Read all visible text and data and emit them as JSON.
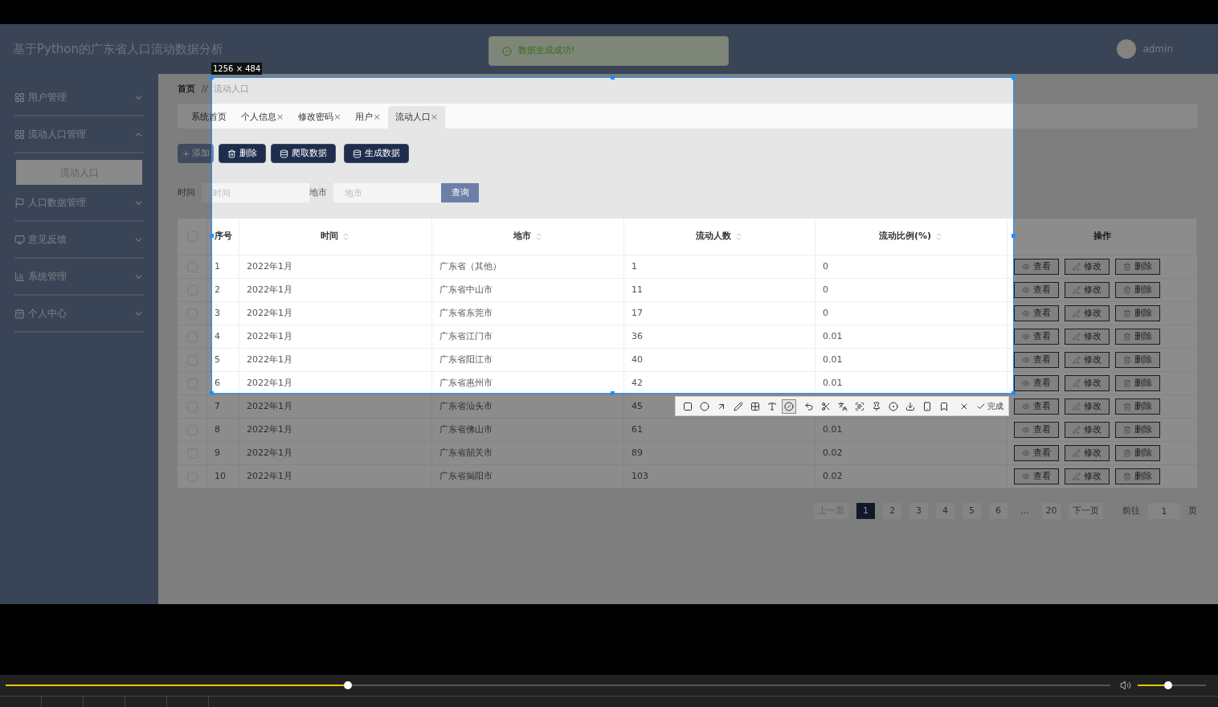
{
  "app": {
    "header": {
      "title": "基于Python的广东省人口流动数据分析",
      "user": "admin"
    },
    "toast": {
      "message": "数据生成成功!"
    },
    "sidebar": {
      "items": [
        {
          "kind": "grid",
          "label": "用户管理",
          "expanded": false
        },
        {
          "kind": "grid",
          "label": "流动人口管理",
          "expanded": true,
          "children": [
            {
              "label": "流动人口",
              "selected": true
            }
          ]
        },
        {
          "kind": "flag",
          "label": "人口数据管理",
          "expanded": false
        },
        {
          "kind": "monitor",
          "label": "意见反馈",
          "expanded": false
        },
        {
          "kind": "chart",
          "label": "系统管理",
          "expanded": false
        },
        {
          "kind": "calendar",
          "label": "个人中心",
          "expanded": false
        }
      ]
    },
    "breadcrumb": {
      "items": [
        "首页",
        "流动人口"
      ],
      "separator": "//"
    },
    "tabs": [
      {
        "label": "系统首页",
        "selected": false
      },
      {
        "label": "个人信息",
        "close": "×",
        "selected": false
      },
      {
        "label": "修改密码",
        "close": "×",
        "selected": false
      },
      {
        "label": "用户",
        "close": "×",
        "selected": false
      },
      {
        "label": "流动人口",
        "close": "×",
        "selected": true
      }
    ],
    "actions": [
      {
        "kind": "add",
        "label": "添加"
      },
      {
        "kind": "delete",
        "label": "删除"
      },
      {
        "kind": "crawl",
        "label": "爬取数据"
      },
      {
        "kind": "generate",
        "label": "生成数据"
      }
    ],
    "search": {
      "fields": [
        {
          "label": "时间",
          "placeholder": "时间"
        },
        {
          "label": "地市",
          "placeholder": "地市"
        }
      ],
      "button": "查询"
    },
    "table": {
      "columns": [
        {
          "label": "序号",
          "sortable": false
        },
        {
          "label": "时间",
          "sortable": true
        },
        {
          "label": "地市",
          "sortable": true
        },
        {
          "label": "流动人数",
          "sortable": true
        },
        {
          "label": "流动比例(%)",
          "sortable": true
        },
        {
          "label": "操作",
          "sortable": false
        }
      ],
      "select_all": {
        "checked": false
      },
      "rows": [
        {
          "checked": false,
          "no": "1",
          "time": "2022年1月",
          "city": "广东省（其他）",
          "count": "1",
          "ratio": "0",
          "actions": [
            "查看",
            "修改",
            "删除"
          ]
        },
        {
          "checked": false,
          "no": "2",
          "time": "2022年1月",
          "city": "广东省中山市",
          "count": "11",
          "ratio": "0",
          "actions": [
            "查看",
            "修改",
            "删除"
          ]
        },
        {
          "checked": false,
          "no": "3",
          "time": "2022年1月",
          "city": "广东省东莞市",
          "count": "17",
          "ratio": "0",
          "actions": [
            "查看",
            "修改",
            "删除"
          ]
        },
        {
          "checked": false,
          "no": "4",
          "time": "2022年1月",
          "city": "广东省江门市",
          "count": "36",
          "ratio": "0.01",
          "actions": [
            "查看",
            "修改",
            "删除"
          ]
        },
        {
          "checked": false,
          "no": "5",
          "time": "2022年1月",
          "city": "广东省阳江市",
          "count": "40",
          "ratio": "0.01",
          "actions": [
            "查看",
            "修改",
            "删除"
          ]
        },
        {
          "checked": false,
          "no": "6",
          "time": "2022年1月",
          "city": "广东省惠州市",
          "count": "42",
          "ratio": "0.01",
          "actions": [
            "查看",
            "修改",
            "删除"
          ]
        },
        {
          "checked": false,
          "no": "7",
          "time": "2022年1月",
          "city": "广东省汕头市",
          "count": "45",
          "actions": [
            "查看",
            "修改",
            "删除"
          ]
        },
        {
          "checked": false,
          "no": "8",
          "time": "2022年1月",
          "city": "广东省佛山市",
          "count": "61",
          "ratio": "0.01",
          "actions": [
            "查看",
            "修改",
            "删除"
          ]
        },
        {
          "checked": false,
          "no": "9",
          "time": "2022年1月",
          "city": "广东省韶关市",
          "count": "89",
          "ratio": "0.02",
          "actions": [
            "查看",
            "修改",
            "删除"
          ]
        },
        {
          "checked": false,
          "no": "10",
          "time": "2022年1月",
          "city": "广东省揭阳市",
          "count": "103",
          "ratio": "0.02",
          "actions": [
            "查看",
            "修改",
            "删除"
          ]
        }
      ]
    },
    "pagination": {
      "prev": "上一页",
      "next": "下一页",
      "pages": [
        {
          "label": "1",
          "selected": true
        },
        {
          "label": "2",
          "selected": false
        },
        {
          "label": "3",
          "selected": false
        },
        {
          "label": "4",
          "selected": false
        },
        {
          "label": "5",
          "selected": false
        },
        {
          "label": "6",
          "selected": false
        },
        {
          "label": "...",
          "kind": "more",
          "selected": false
        },
        {
          "label": "20",
          "selected": false
        }
      ],
      "goto_label": "前往",
      "goto_value": "1",
      "goto_suffix": "页"
    }
  },
  "capture": {
    "size_label": "1256 × 484",
    "done": "完成",
    "tools": [
      {
        "kind": "rectangle",
        "selected": false
      },
      {
        "kind": "ellipse",
        "selected": false
      },
      {
        "kind": "arrow",
        "selected": false
      },
      {
        "kind": "pencil",
        "selected": false
      },
      {
        "kind": "mosaic",
        "selected": false
      },
      {
        "kind": "text",
        "selected": false
      },
      {
        "kind": "marker",
        "selected": true
      },
      {
        "kind": "undo",
        "selected": false
      },
      {
        "kind": "cut",
        "selected": false
      },
      {
        "kind": "translate",
        "selected": false
      },
      {
        "kind": "scan",
        "selected": false
      },
      {
        "kind": "pin",
        "selected": false
      },
      {
        "kind": "record",
        "selected": false
      },
      {
        "kind": "download",
        "selected": false
      },
      {
        "kind": "phone",
        "selected": false
      },
      {
        "kind": "bookmark",
        "selected": false
      },
      {
        "kind": "close",
        "selected": false
      }
    ]
  },
  "player": {
    "progress": {
      "level": 0.31
    },
    "volume": {
      "level": 0.45
    }
  }
}
